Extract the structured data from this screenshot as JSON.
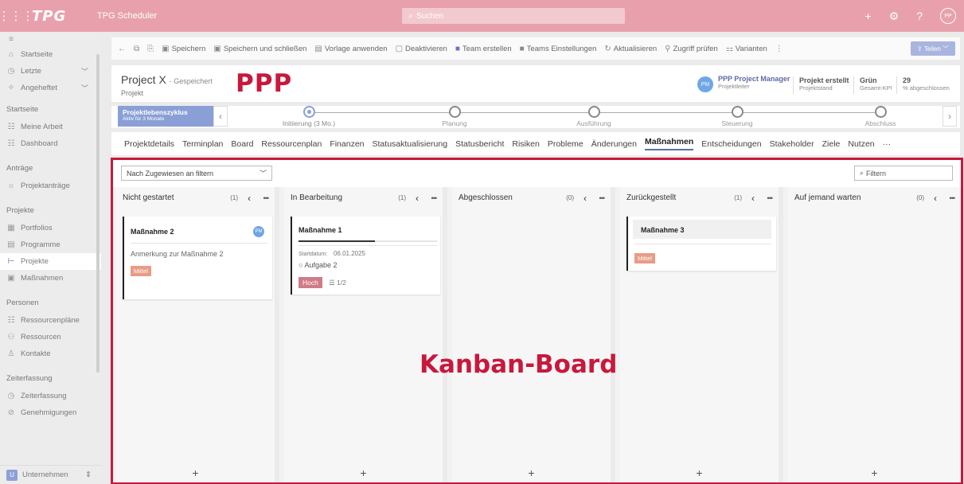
{
  "header": {
    "logo": "TPG",
    "app_name": "TPG Scheduler",
    "search_placeholder": "Suchen",
    "user_initials": "PP"
  },
  "sidebar": {
    "items_top": [
      {
        "label": "Startseite",
        "icon": "home-icon"
      },
      {
        "label": "Letzte",
        "icon": "clock-icon"
      },
      {
        "label": "Angeheftet",
        "icon": "pin-icon"
      }
    ],
    "section_start": "Startseite",
    "items_start": [
      {
        "label": "Meine Arbeit",
        "icon": "tasks-icon"
      },
      {
        "label": "Dashboard",
        "icon": "dashboard-icon"
      }
    ],
    "section_antraege": "Anträge",
    "items_antraege": [
      {
        "label": "Projektanträge",
        "icon": "bulb-icon"
      }
    ],
    "section_projekte": "Projekte",
    "items_projekte": [
      {
        "label": "Portfolios",
        "icon": "portfolio-icon"
      },
      {
        "label": "Programme",
        "icon": "program-icon"
      },
      {
        "label": "Projekte",
        "icon": "project-icon"
      },
      {
        "label": "Maßnahmen",
        "icon": "measure-icon"
      }
    ],
    "section_personen": "Personen",
    "items_personen": [
      {
        "label": "Ressourcenpläne",
        "icon": "resourceplan-icon"
      },
      {
        "label": "Ressourcen",
        "icon": "people-icon"
      },
      {
        "label": "Kontakte",
        "icon": "contact-icon"
      }
    ],
    "section_zeit": "Zeiterfassung",
    "items_zeit": [
      {
        "label": "Zeiterfassung",
        "icon": "clock-icon"
      },
      {
        "label": "Genehmigungen",
        "icon": "check-circle-icon"
      }
    ],
    "bottom": {
      "badge": "U",
      "label": "Unternehmen"
    }
  },
  "commandbar": {
    "items": [
      "Speichern",
      "Speichern und schließen",
      "Vorlage anwenden",
      "Deaktivieren",
      "Team erstellen",
      "Teams Einstellungen",
      "Aktualisieren",
      "Zugriff prüfen",
      "Varianten"
    ],
    "share": "Teilen"
  },
  "record": {
    "title": "Project X",
    "saved": "- Gespeichert",
    "entity": "Projekt",
    "owner_name": "PPP Project Manager",
    "owner_role": "Projektleiter",
    "owner_initials": "PM",
    "kpi": [
      {
        "value": "Projekt erstellt",
        "label": "Projektstand"
      },
      {
        "value": "Grün",
        "label": "Gesamt-KPI"
      },
      {
        "value": "29",
        "label": "% abgeschlossen"
      }
    ]
  },
  "overlay": {
    "ppp": "PPP",
    "kanban": "Kanban-Board"
  },
  "lifecycle": {
    "name": "Projektlebenszyklus",
    "duration": "Aktiv für 3 Monate",
    "stages": [
      "Initiierung  (3 Mo.)",
      "Planung",
      "Ausführung",
      "Steuerung",
      "Abschluss"
    ],
    "active_index": 0
  },
  "tabs": [
    "Projektdetails",
    "Terminplan",
    "Board",
    "Ressourcenplan",
    "Finanzen",
    "Statusaktualisierung",
    "Statusbericht",
    "Risiken",
    "Probleme",
    "Änderungen",
    "Maßnahmen",
    "Entscheidungen",
    "Stakeholder",
    "Ziele",
    "Nutzen",
    "···"
  ],
  "active_tab": "Maßnahmen",
  "board": {
    "filter_select": "Nach Zugewiesen an filtern",
    "filter_placeholder": "Filtern",
    "columns": [
      {
        "title": "Nicht gestartet",
        "count": "(1)"
      },
      {
        "title": "In Bearbeitung",
        "count": "(1)"
      },
      {
        "title": "Abgeschlossen",
        "count": "(0)"
      },
      {
        "title": "Zurückgestellt",
        "count": "(1)"
      },
      {
        "title": "Auf jemand warten",
        "count": "(0)"
      }
    ],
    "cards": {
      "c1": {
        "title": "Maßnahme 2",
        "note": "Anmerkung zur Maßnahme 2",
        "priority": "Mittel",
        "assignee": "PM"
      },
      "c2": {
        "title": "Maßnahme 1",
        "start_label": "Startdatum:",
        "start_date": "06.01.2025",
        "task": "Aufgabe 2",
        "priority": "Hoch",
        "checklist": "1/2",
        "progress": 0.55
      },
      "c3": {
        "title": "Maßnahme 3",
        "priority": "Mittel"
      }
    },
    "add": "+"
  }
}
